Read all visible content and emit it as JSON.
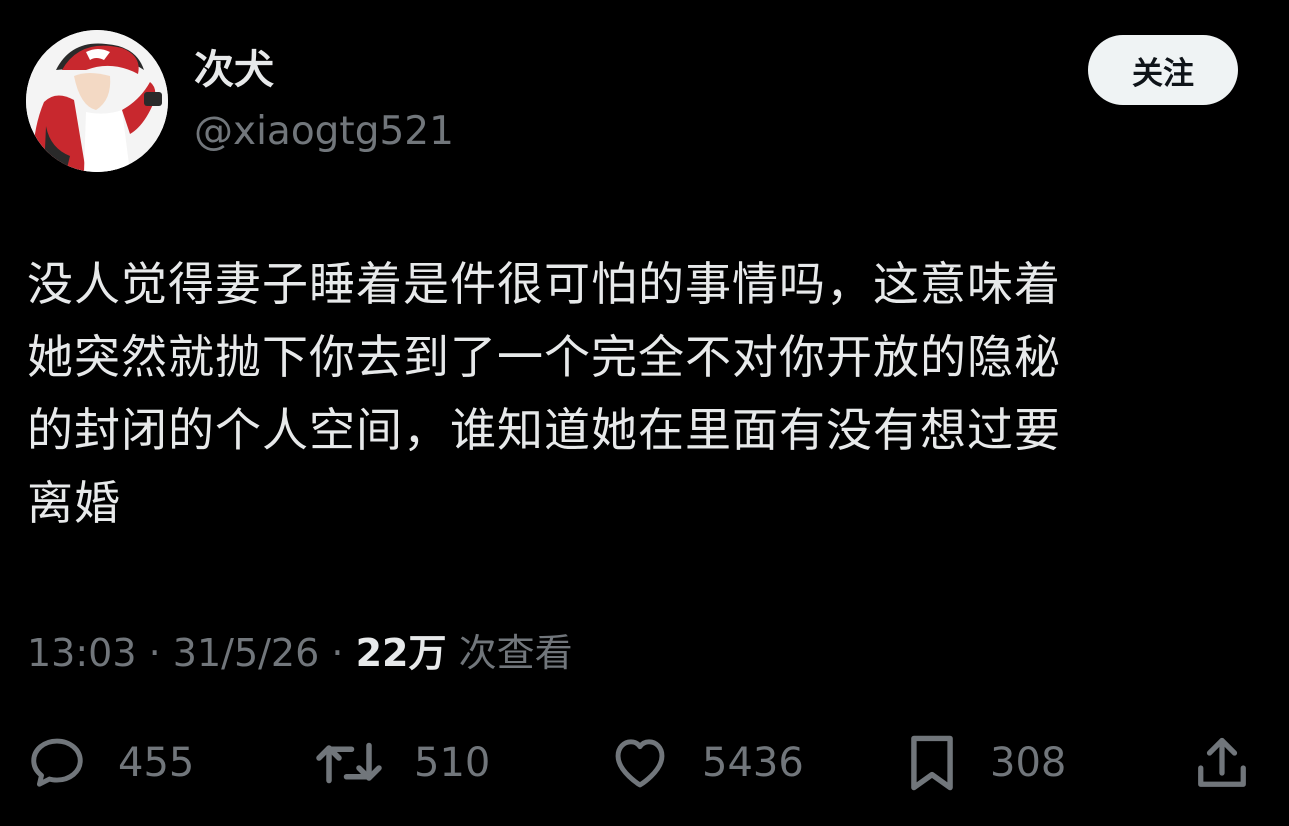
{
  "author": {
    "display_name": "次犬",
    "handle": "@xiaogtg521"
  },
  "follow_button": {
    "label": "关注"
  },
  "tweet": {
    "text_lines": [
      "没人觉得妻子睡着是件很可怕的事情吗，这意味着",
      "她突然就抛下你去到了一个完全不对你开放的隐秘",
      "的封闭的个人空间，谁知道她在里面有没有想过要",
      "离婚"
    ]
  },
  "meta": {
    "time": "13:03",
    "separator": "·",
    "date": "31/5/26",
    "views_count": "22万",
    "views_label": "次查看"
  },
  "actions": {
    "reply": {
      "icon": "reply-icon",
      "count": "455"
    },
    "retweet": {
      "icon": "retweet-icon",
      "count": "510"
    },
    "like": {
      "icon": "heart-icon",
      "count": "5436"
    },
    "bookmark": {
      "icon": "bookmark-icon",
      "count": "308"
    },
    "share": {
      "icon": "share-icon"
    }
  },
  "colors": {
    "background": "#000000",
    "primary_text": "#e7e9ea",
    "secondary_text": "#71767b",
    "button_bg": "#eff3f4",
    "button_text": "#0f1419"
  }
}
